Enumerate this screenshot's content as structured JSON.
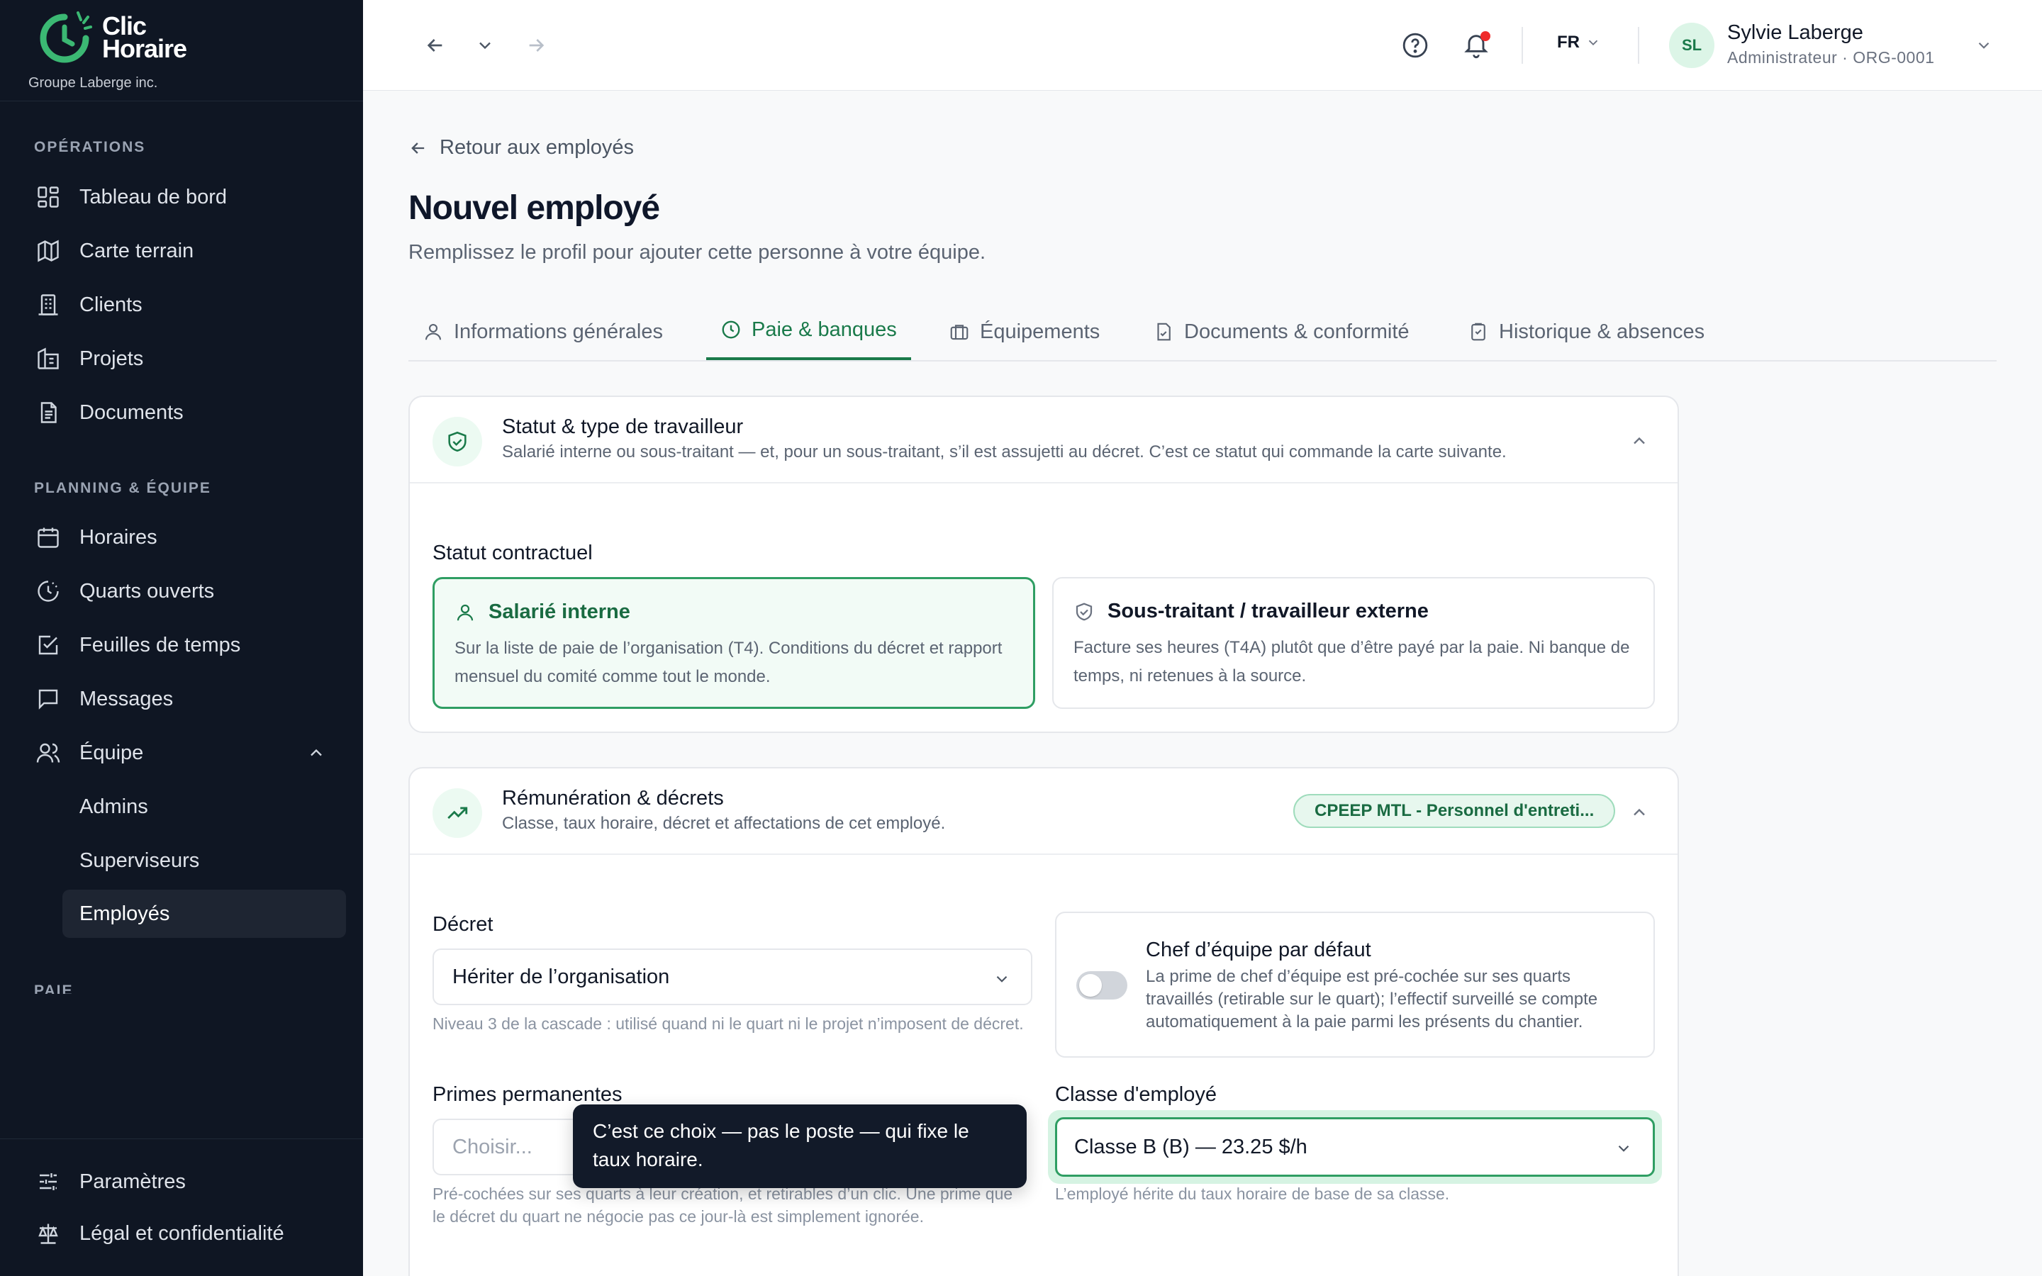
{
  "app": {
    "name_line1": "Clic",
    "name_line2": "Horaire",
    "org": "Groupe Laberge inc.",
    "accent": "#1a7a4a"
  },
  "sidebar": {
    "sections": [
      {
        "title": "OPÉRATIONS"
      },
      {
        "title": "PLANNING & ÉQUIPE"
      },
      {
        "title": "PAIE"
      }
    ],
    "items": [
      {
        "label": "Tableau de bord",
        "icon": "dashboard-icon"
      },
      {
        "label": "Carte terrain",
        "icon": "map-icon"
      },
      {
        "label": "Clients",
        "icon": "building-icon"
      },
      {
        "label": "Projets",
        "icon": "projects-icon"
      },
      {
        "label": "Documents",
        "icon": "document-icon"
      },
      {
        "label": "Horaires",
        "icon": "calendar-icon"
      },
      {
        "label": "Quarts ouverts",
        "icon": "clock-icon"
      },
      {
        "label": "Feuilles de temps",
        "icon": "timesheet-icon"
      },
      {
        "label": "Messages",
        "icon": "message-icon"
      },
      {
        "label": "Équipe",
        "icon": "users-icon"
      },
      {
        "label": "Admins"
      },
      {
        "label": "Superviseurs"
      },
      {
        "label": "Employés"
      }
    ],
    "footer": [
      {
        "label": "Paramètres",
        "icon": "sliders-icon"
      },
      {
        "label": "Légal et confidentialité",
        "icon": "scale-icon"
      }
    ]
  },
  "topbar": {
    "language": "FR",
    "user": {
      "initials": "SL",
      "name": "Sylvie Laberge",
      "role": "Administrateur · ORG-0001"
    }
  },
  "page": {
    "back_label": "Retour aux employés",
    "title": "Nouvel employé",
    "subtitle": "Remplissez le profil pour ajouter cette personne à votre équipe."
  },
  "tabs": [
    {
      "label": "Informations générales",
      "icon": "user-icon"
    },
    {
      "label": "Paie & banques",
      "icon": "clock-icon"
    },
    {
      "label": "Équipements",
      "icon": "briefcase-icon"
    },
    {
      "label": "Documents & conformité",
      "icon": "document-check-icon"
    },
    {
      "label": "Historique & absences",
      "icon": "clipboard-icon"
    }
  ],
  "statut_card": {
    "title": "Statut & type de travailleur",
    "description": "Salarié interne ou sous-traitant — et, pour un sous-traitant, s’il est assujetti au décret. C’est ce statut qui commande la carte suivante.",
    "field_label": "Statut contractuel",
    "options": [
      {
        "title": "Salarié interne",
        "description": "Sur la liste de paie de l’organisation (T4). Conditions du décret et rapport mensuel du comité comme tout le monde.",
        "selected": true
      },
      {
        "title": "Sous-traitant / travailleur externe",
        "description": "Facture ses heures (T4A) plutôt que d’être payé par la paie. Ni banque de temps, ni retenues à la source.",
        "selected": false
      }
    ]
  },
  "remuneration_card": {
    "title": "Rémunération & décrets",
    "description": "Classe, taux horaire, décret et affectations de cet employé.",
    "badge": "CPEEP MTL - Personnel d'entreti...",
    "decret": {
      "label": "Décret",
      "value": "Hériter de l’organisation",
      "hint": "Niveau 3 de la cascade : utilisé quand ni le quart ni le projet n’imposent de décret."
    },
    "chef": {
      "title": "Chef d’équipe par défaut",
      "description": "La prime de chef d’équipe est pré-cochée sur ses quarts travaillés (retirable sur le quart); l’effectif surveillé se compte automatiquement à la paie parmi les présents du chantier.",
      "enabled": false
    },
    "primes": {
      "label": "Primes permanentes",
      "placeholder": "Choisir...",
      "hint": "Pré-cochées sur ses quarts à leur création, et retirables d’un clic. Une prime que le décret du quart ne négocie pas ce jour-là est simplement ignorée."
    },
    "classe": {
      "label": "Classe d'employé",
      "value": "Classe B (B) — 23.25 $/h",
      "hint": "L’employé hérite du taux horaire de base de sa classe."
    }
  },
  "tooltip": {
    "text": "C’est ce choix — pas le poste — qui fixe le taux horaire."
  }
}
